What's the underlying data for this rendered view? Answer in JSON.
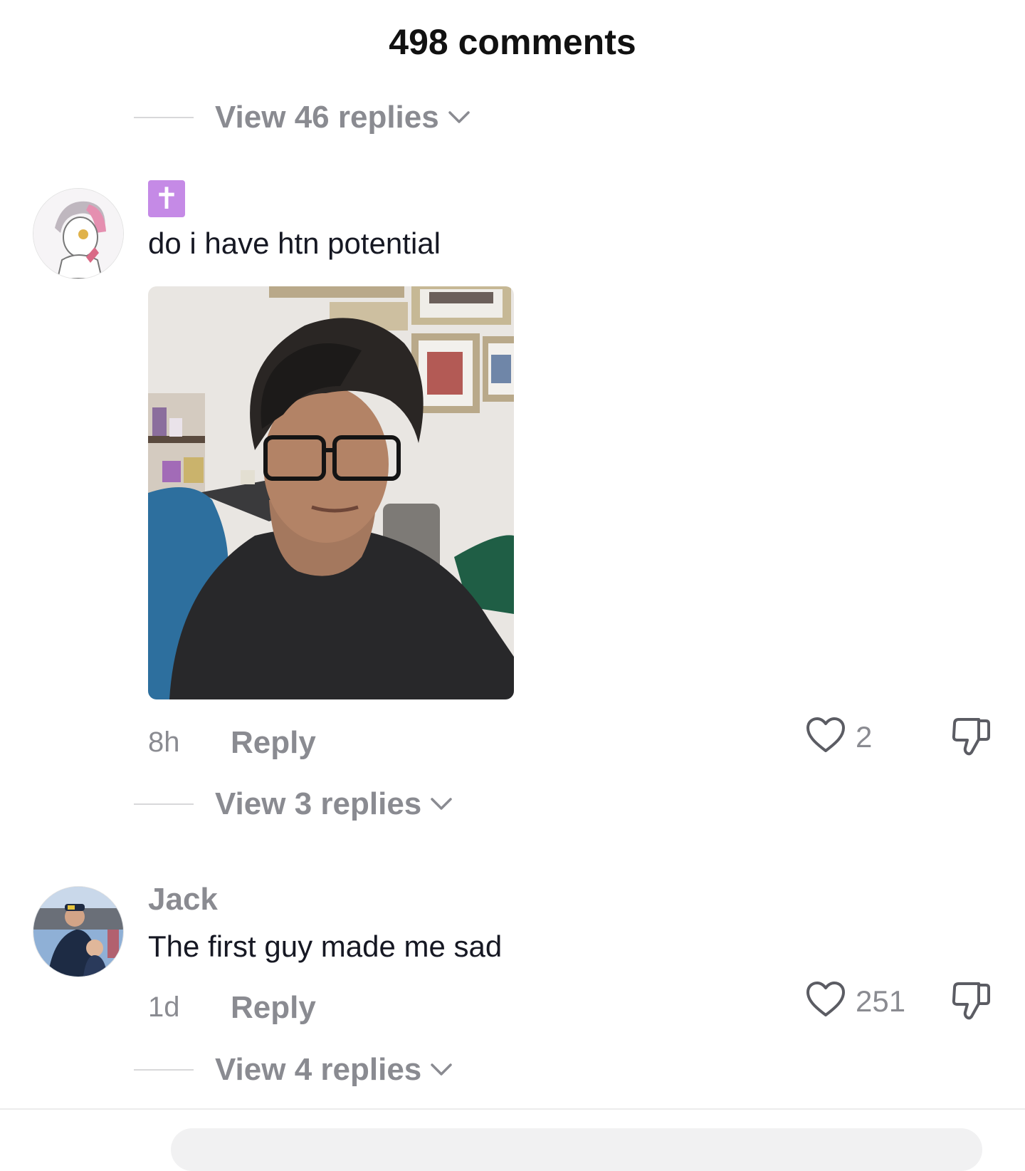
{
  "header": {
    "title": "498 comments"
  },
  "threads": [
    {
      "view_replies_label": "View 46 replies"
    },
    {
      "username_emoji": "✝",
      "text": "do i have htn potential",
      "time": "8h",
      "reply_label": "Reply",
      "likes": "2",
      "view_replies_label": "View 3 replies"
    },
    {
      "username": "Jack",
      "text": "The first guy made me sad",
      "time": "1d",
      "reply_label": "Reply",
      "likes": "251",
      "view_replies_label": "View 4 replies"
    }
  ],
  "icons": {
    "chevron": "chevron-down-icon",
    "like": "heart-icon",
    "dislike": "thumbs-down-icon"
  },
  "colors": {
    "secondary_text": "#8a8b91",
    "primary_text": "#161823",
    "emoji_bg": "#c58ae6"
  }
}
